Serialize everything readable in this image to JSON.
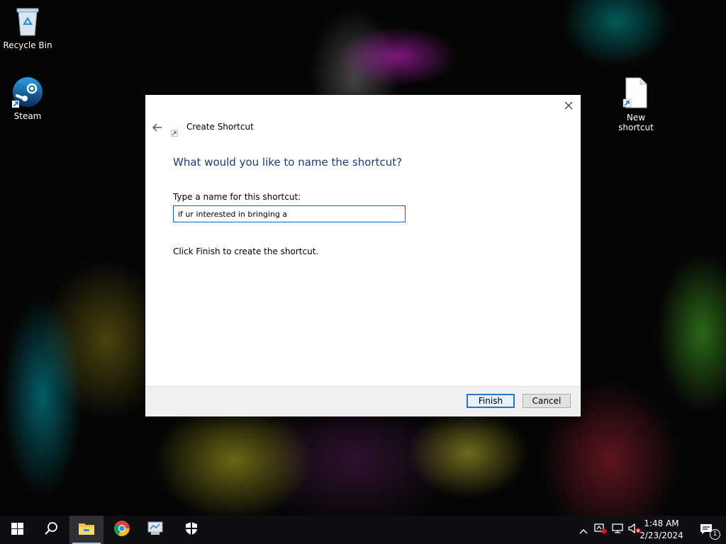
{
  "desktop": {
    "icons": [
      {
        "label": "Recycle Bin"
      },
      {
        "label": "Steam"
      },
      {
        "label": "New shortcut"
      }
    ]
  },
  "dialog": {
    "wizard_title": "Create Shortcut",
    "heading": "What would you like to name the shortcut?",
    "field_label": "Type a name for this shortcut:",
    "name_value": "if ur interested in bringing a",
    "instruction": "Click Finish to create the shortcut.",
    "finish_label": "Finish",
    "cancel_label": "Cancel"
  },
  "taskbar": {
    "time": "1:48 AM",
    "date": "2/23/2024",
    "notification_count": "1",
    "pinned": [
      "start-icon",
      "search-icon",
      "file-explorer-icon",
      "chrome-icon",
      "app-icon",
      "security-icon"
    ]
  },
  "colors": {
    "accent": "#0a64c4",
    "heading": "#1c3a78",
    "taskbar": "#101014"
  }
}
